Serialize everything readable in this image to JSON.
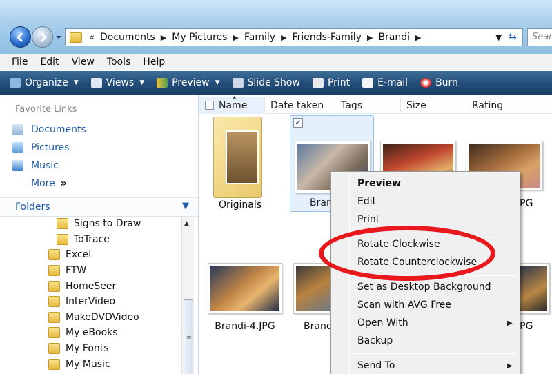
{
  "address_bar": {
    "breadcrumbs": [
      "Documents",
      "My Pictures",
      "Family",
      "Friends-Family",
      "Brandi"
    ],
    "search_placeholder": "Search"
  },
  "menu": [
    "File",
    "Edit",
    "View",
    "Tools",
    "Help"
  ],
  "toolbar": [
    {
      "label": "Organize",
      "icon": "organize-icon",
      "dropdown": true
    },
    {
      "label": "Views",
      "icon": "views-icon",
      "dropdown": true
    },
    {
      "label": "Preview",
      "icon": "preview-icon",
      "dropdown": true
    },
    {
      "label": "Slide Show",
      "icon": "slideshow-icon",
      "dropdown": false
    },
    {
      "label": "Print",
      "icon": "print-icon",
      "dropdown": false
    },
    {
      "label": "E-mail",
      "icon": "email-icon",
      "dropdown": false
    },
    {
      "label": "Burn",
      "icon": "burn-icon",
      "dropdown": false
    }
  ],
  "left_pane": {
    "favorite_links_title": "Favorite Links",
    "favorites": [
      "Documents",
      "Pictures",
      "Music"
    ],
    "more_label": "More",
    "more_arrows": "»",
    "folders_title": "Folders",
    "tree": [
      {
        "label": "Signs to Draw",
        "indent": 2
      },
      {
        "label": "ToTrace",
        "indent": 2
      },
      {
        "label": "Excel",
        "indent": 1
      },
      {
        "label": "FTW",
        "indent": 1
      },
      {
        "label": "HomeSeer",
        "indent": 1
      },
      {
        "label": "InterVideo",
        "indent": 1
      },
      {
        "label": "MakeDVDVideo",
        "indent": 1
      },
      {
        "label": "My eBooks",
        "indent": 1
      },
      {
        "label": "My Fonts",
        "indent": 1
      },
      {
        "label": "My Music",
        "indent": 1
      }
    ]
  },
  "columns": [
    "Name",
    "Date taken",
    "Tags",
    "Size",
    "Rating"
  ],
  "files": {
    "folder_label": "Originals",
    "row1_label_partial": "Bran",
    "row1_right_label": "JPG",
    "row2_label_a": "Brandi-4.JPG",
    "row2_label_b_partial": "Brand",
    "row2_right_label": "JPG",
    "selected_check": "✓"
  },
  "context_menu": {
    "items": [
      {
        "label": "Preview",
        "bold": true
      },
      {
        "label": "Edit"
      },
      {
        "label": "Print"
      },
      {
        "label": "Rotate Clockwise"
      },
      {
        "label": "Rotate Counterclockwise"
      },
      {
        "label": "Set as Desktop Background"
      },
      {
        "label": "Scan with AVG Free"
      },
      {
        "label": "Open With",
        "submenu": true
      },
      {
        "label": "Backup"
      },
      {
        "label": "Send To",
        "submenu": true
      }
    ],
    "submenu_arrow": "▶"
  },
  "colors": {
    "toolbar_bg": "#244f7b",
    "link_blue": "#1d5aa8",
    "highlight_ring": "#e8181c",
    "selection_bg": "#e4f0fc"
  }
}
